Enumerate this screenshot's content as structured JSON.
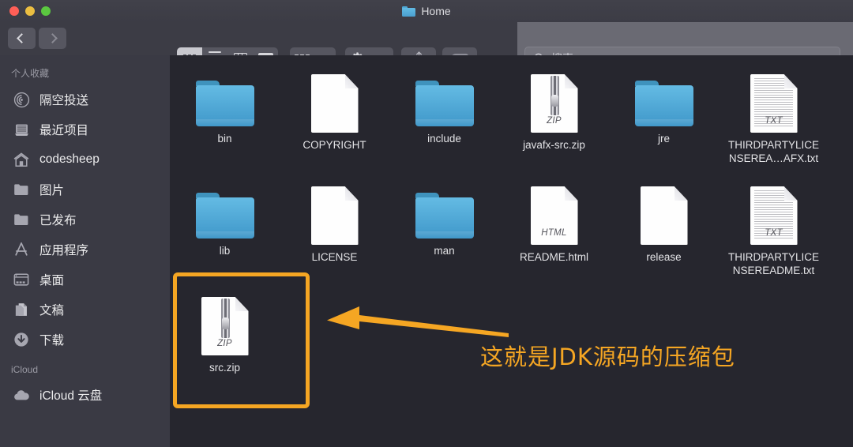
{
  "window": {
    "title": "Home",
    "traffic_lights": [
      "close",
      "minimize",
      "zoom"
    ],
    "colors": {
      "accent_orange": "#f5a623",
      "folder_blue": "#4fa9d6",
      "sidebar_bg": "#3a3a44",
      "content_bg": "#26262e",
      "toolbar_bg": "#3c3c45"
    }
  },
  "toolbar": {
    "back_label": "Back",
    "forward_label": "Forward",
    "view_modes": [
      {
        "name": "icon-view",
        "label": "Icon View",
        "active": true
      },
      {
        "name": "list-view",
        "label": "List View",
        "active": false
      },
      {
        "name": "column-view",
        "label": "Column View",
        "active": false
      },
      {
        "name": "gallery-view",
        "label": "Gallery View",
        "active": false
      }
    ],
    "arrange_label": "Arrange By",
    "action_label": "Action",
    "share_label": "Share",
    "tag_label": "Edit Tags",
    "search": {
      "placeholder": "搜索",
      "value": ""
    }
  },
  "sidebar": {
    "sections": [
      {
        "header": "个人收藏",
        "items": [
          {
            "label": "隔空投送",
            "icon": "airdrop-icon"
          },
          {
            "label": "最近项目",
            "icon": "recents-icon"
          },
          {
            "label": "codesheep",
            "icon": "home-icon"
          },
          {
            "label": "图片",
            "icon": "folder-icon"
          },
          {
            "label": "已发布",
            "icon": "folder-icon"
          },
          {
            "label": "应用程序",
            "icon": "applications-icon"
          },
          {
            "label": "桌面",
            "icon": "desktop-icon"
          },
          {
            "label": "文稿",
            "icon": "documents-icon"
          },
          {
            "label": "下载",
            "icon": "downloads-icon"
          }
        ]
      },
      {
        "header": "iCloud",
        "items": [
          {
            "label": "iCloud 云盘",
            "icon": "cloud-icon"
          }
        ]
      }
    ]
  },
  "files": {
    "rows": [
      [
        {
          "name": "bin",
          "type": "folder",
          "kind": ""
        },
        {
          "name": "COPYRIGHT",
          "type": "document",
          "kind": ""
        },
        {
          "name": "include",
          "type": "folder",
          "kind": ""
        },
        {
          "name": "javafx-src.zip",
          "type": "zip",
          "kind": "ZIP"
        },
        {
          "name": "jre",
          "type": "folder",
          "kind": ""
        },
        {
          "name": "THIRDPARTYLICENSEREA…AFX.txt",
          "type": "text",
          "kind": "TXT"
        }
      ],
      [
        {
          "name": "lib",
          "type": "folder",
          "kind": ""
        },
        {
          "name": "LICENSE",
          "type": "document",
          "kind": ""
        },
        {
          "name": "man",
          "type": "folder",
          "kind": ""
        },
        {
          "name": "README.html",
          "type": "html",
          "kind": "HTML"
        },
        {
          "name": "release",
          "type": "document",
          "kind": ""
        },
        {
          "name": "THIRDPARTYLICENSEREADME.txt",
          "type": "text",
          "kind": "TXT"
        }
      ],
      [
        {
          "name": "src.zip",
          "type": "zip",
          "kind": "ZIP",
          "highlighted": true
        }
      ]
    ]
  },
  "annotation": {
    "text": "这就是JDK源码的压缩包",
    "color": "#f5a623",
    "arrow_direction": "left",
    "highlight_target": "src.zip"
  }
}
